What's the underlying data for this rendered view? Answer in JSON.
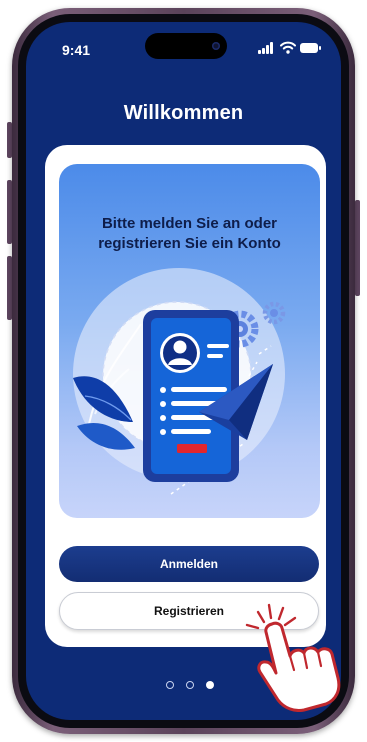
{
  "status_bar": {
    "time": "9:41",
    "icons": [
      "signal-icon",
      "wifi-icon",
      "battery-icon"
    ]
  },
  "page": {
    "title": "Willkommen"
  },
  "card": {
    "prompt": "Bitte melden Sie an oder registrieren Sie ein Konto",
    "illustration": "profile-document-with-paper-plane-and-gears"
  },
  "buttons": {
    "login_label": "Anmelden",
    "register_label": "Registrieren"
  },
  "pager": {
    "total": 3,
    "active_index": 2
  },
  "overlay": {
    "icon": "tapping-hand-icon"
  },
  "colors": {
    "screen_bg": "#0d2b77",
    "accent_button": "#132d73",
    "panel_top": "#4c8be9",
    "panel_bottom": "#c7d4fa",
    "hand_outline": "#c0282e"
  }
}
